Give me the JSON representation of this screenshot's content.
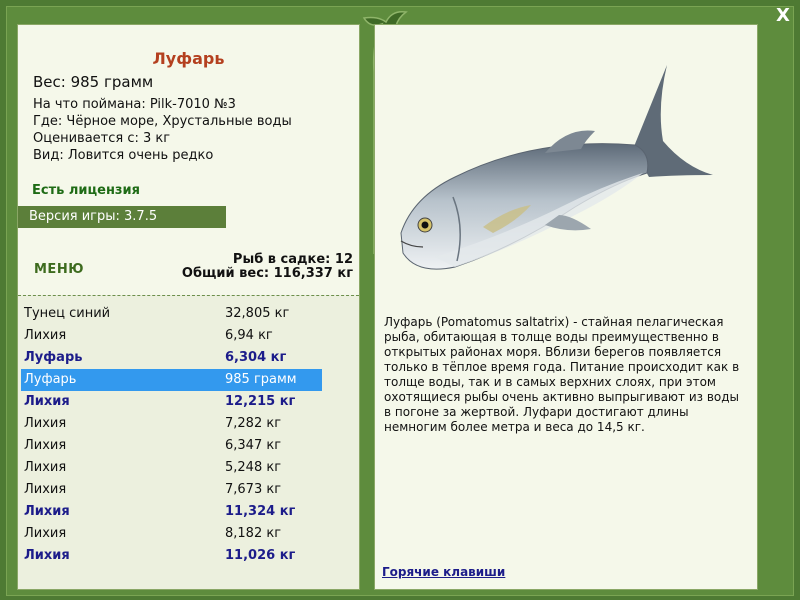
{
  "window": {
    "close_label": "X"
  },
  "fish": {
    "title": "Луфарь",
    "weight_line": "Вес: 985 грамм",
    "details": [
      "На что поймана: Pilk-7010 №3",
      "Где: Чёрное море, Хрустальные воды",
      "Оценивается с: 3 кг",
      "Вид: Ловится очень редко"
    ],
    "license": "Есть лицензия",
    "version": "Версия игры: 3.7.5",
    "description": "Луфарь (Pomatomus saltatrix) - стайная пелагическая рыба, обитающая в толще воды преимущественно в открытых районах моря. Вблизи берегов появляется только в тёплое время года. Питание происходит как в толще воды, так и в самых верхних слоях, при этом охотящиеся рыбы очень активно выпрыгивают из воды в погоне за жертвой. Луфари достигают длины немногим более метра и веса до 14,5 кг."
  },
  "menu": {
    "label": "МЕНЮ"
  },
  "cage": {
    "count_line": "Рыб в садке: 12",
    "total_line": "Общий вес: 116,337 кг"
  },
  "catch_list": [
    {
      "name": "Тунец синий",
      "weight": "32,805 кг"
    },
    {
      "name": "Лихия",
      "weight": "6,94 кг"
    },
    {
      "name": "Луфарь",
      "weight": "6,304 кг"
    },
    {
      "name": "Луфарь",
      "weight": "985 грамм"
    },
    {
      "name": "Лихия",
      "weight": "12,215 кг"
    },
    {
      "name": "Лихия",
      "weight": "7,282 кг"
    },
    {
      "name": "Лихия",
      "weight": "6,347 кг"
    },
    {
      "name": "Лихия",
      "weight": "5,248 кг"
    },
    {
      "name": "Лихия",
      "weight": "7,673 кг"
    },
    {
      "name": "Лихия",
      "weight": "11,324 кг"
    },
    {
      "name": "Лихия",
      "weight": "8,182 кг"
    },
    {
      "name": "Лихия",
      "weight": "11,026 кг"
    }
  ],
  "hotkeys_label": "Горячие клавиши",
  "colors": {
    "frame": "#4e7a33",
    "title": "#b4401f",
    "license": "#1e6b15",
    "highlight": "#1c1c8a",
    "selected": "#3399ee"
  }
}
